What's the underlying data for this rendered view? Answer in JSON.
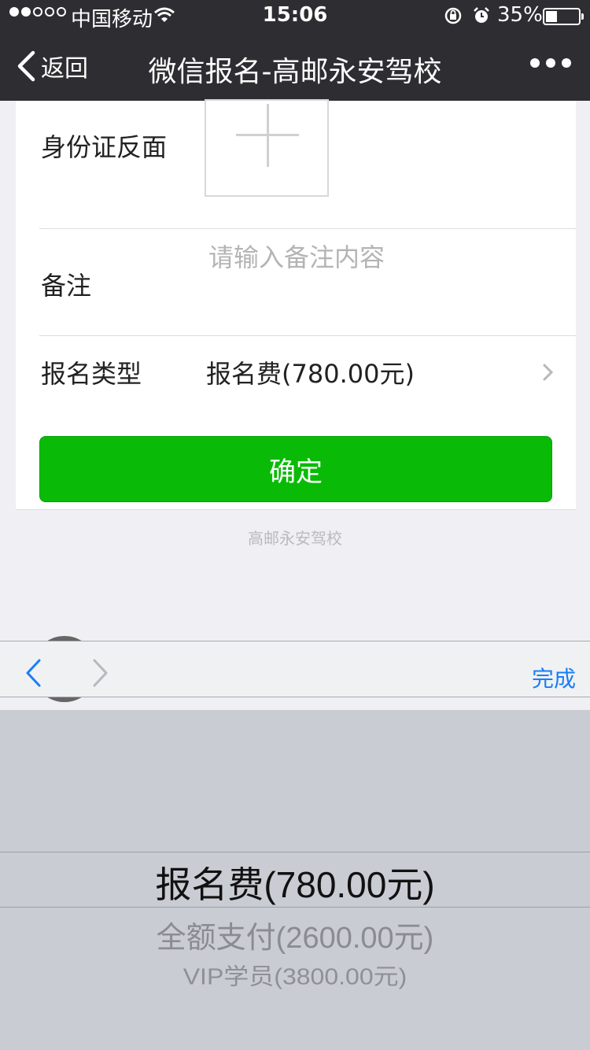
{
  "status_bar": {
    "carrier": "中国移动",
    "time": "15:06",
    "battery": "35%",
    "battery_level": 0.35
  },
  "nav": {
    "back_label": "返回",
    "title": "微信报名-高邮永安驾校"
  },
  "form": {
    "id_back_label": "身份证反面",
    "note_label": "备注",
    "note_placeholder": "请输入备注内容",
    "type_label": "报名类型",
    "type_value": "报名费(780.00元)",
    "confirm_label": "确定"
  },
  "footer": {
    "text": "高邮永安驾校"
  },
  "toolbar": {
    "done_label": "完成"
  },
  "picker": {
    "options": [
      "报名费(780.00元)",
      "全额支付(2600.00元)",
      "VIP学员(3800.00元)"
    ],
    "selected_index": 0
  },
  "colors": {
    "nav_bg": "#2e2e32",
    "confirm_green": "#09bb07",
    "done_blue": "#1a7ef5",
    "picker_bg": "#c9ccd3"
  }
}
